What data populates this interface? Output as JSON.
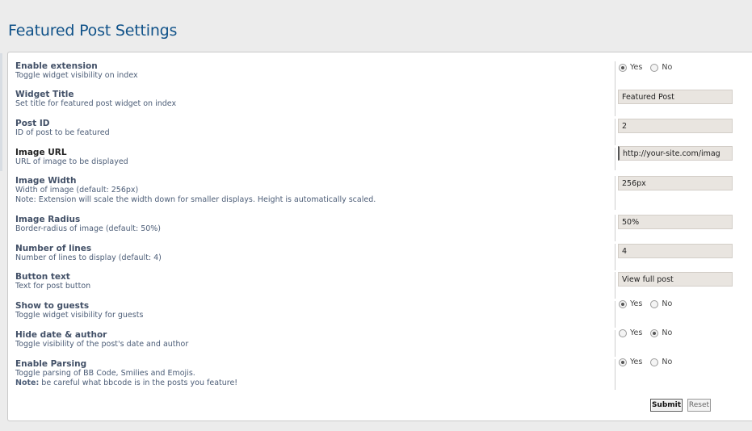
{
  "page": {
    "title": "Featured Post Settings"
  },
  "settings": [
    {
      "title": "Enable extension",
      "desc": "Toggle widget visibility on index",
      "type": "radio",
      "yes": "Yes",
      "no": "No",
      "selected": "yes"
    },
    {
      "title": "Widget Title",
      "desc": "Set title for featured post widget on index",
      "type": "text",
      "value": "Featured Post"
    },
    {
      "title": "Post ID",
      "desc": "ID of post to be featured",
      "type": "text",
      "value": "2"
    },
    {
      "title": "Image URL",
      "desc": "URL of image to be displayed",
      "type": "text",
      "value": "http://your-site.com/imag",
      "focused": true
    },
    {
      "title": "Image Width",
      "desc": "Width of image (default: 256px)",
      "desc2": "Note: Extension will scale the width down for smaller displays. Height is automatically scaled.",
      "type": "text",
      "value": "256px"
    },
    {
      "title": "Image Radius",
      "desc": "Border-radius of image (default: 50%)",
      "type": "text",
      "value": "50%"
    },
    {
      "title": "Number of lines",
      "desc": "Number of lines to display (default: 4)",
      "type": "text",
      "value": "4"
    },
    {
      "title": "Button text",
      "desc": "Text for post button",
      "type": "text",
      "value": "View full post"
    },
    {
      "title": "Show to guests",
      "desc": "Toggle widget visibility for guests",
      "type": "radio",
      "yes": "Yes",
      "no": "No",
      "selected": "yes"
    },
    {
      "title": "Hide date & author",
      "desc": "Toggle visibility of the post's date and author",
      "type": "radio",
      "yes": "Yes",
      "no": "No",
      "selected": "no"
    },
    {
      "title": "Enable Parsing",
      "desc": "Toggle parsing of BB Code, Smilies and Emojis.",
      "note_label": "Note:",
      "note_text": " be careful what bbcode is in the posts you feature!",
      "type": "radio",
      "yes": "Yes",
      "no": "No",
      "selected": "yes"
    }
  ],
  "buttons": {
    "submit": "Submit",
    "reset": "Reset"
  }
}
